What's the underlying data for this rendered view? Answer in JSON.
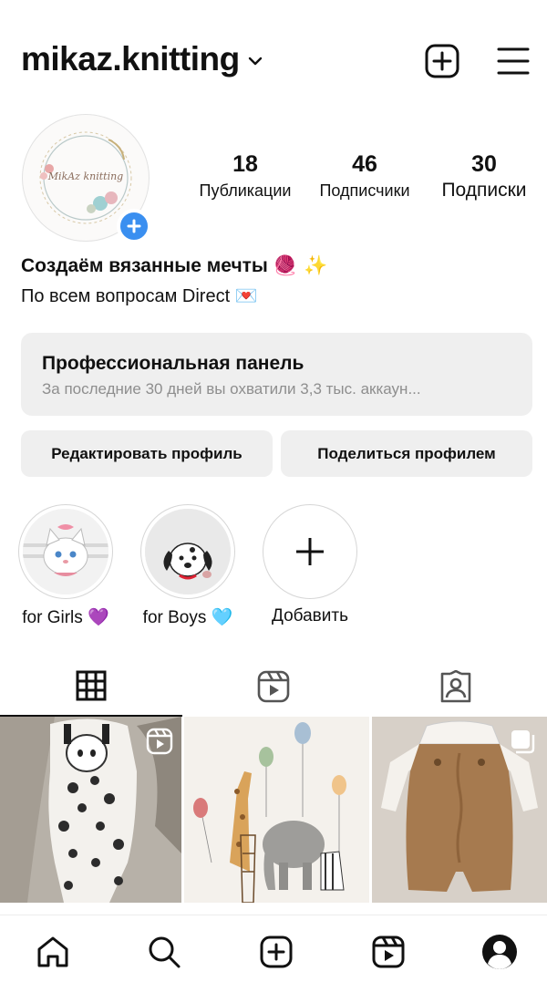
{
  "header": {
    "username": "mikaz.knitting"
  },
  "avatar": {
    "logo_text": "MikAz knitting"
  },
  "stats": {
    "posts": {
      "value": "18",
      "label": "Публикации"
    },
    "followers": {
      "value": "46",
      "label": "Подписчики"
    },
    "following": {
      "value": "30",
      "label": "Подписки"
    }
  },
  "bio": {
    "name": "Создаём вязанные мечты",
    "name_emoji": "🧶 ✨",
    "text": "По всем вопросам Direct",
    "text_emoji": "💌"
  },
  "pro_panel": {
    "title": "Профессиональная панель",
    "subtitle": "За последние 30 дней вы охватили 3,3 тыс. аккаун..."
  },
  "buttons": {
    "edit": "Редактировать профиль",
    "share": "Поделиться профилем"
  },
  "highlights": [
    {
      "label": "for Girls",
      "emoji": "💜",
      "image": "cat-illustration"
    },
    {
      "label": "for Boys",
      "emoji": "🩵",
      "image": "dalmatian-puppy-illustration"
    },
    {
      "label": "Добавить",
      "icon": "plus-icon"
    }
  ],
  "tabs": [
    {
      "icon": "grid-icon",
      "active": true
    },
    {
      "icon": "reels-icon",
      "active": false
    },
    {
      "icon": "tagged-icon",
      "active": false
    }
  ],
  "posts": [
    {
      "image": "knitted-zebra-romper",
      "badge": "reels-icon"
    },
    {
      "image": "animals-with-balloons-illustration",
      "badge": ""
    },
    {
      "image": "knitted-brown-romper",
      "badge": "carousel-icon"
    }
  ],
  "bottom_nav": [
    "home-icon",
    "search-icon",
    "create-icon",
    "reels-icon",
    "profile-icon"
  ],
  "colors": {
    "accent_blue": "#3a8ff0",
    "panel_bg": "#efefef",
    "muted_text": "#8e8e8e"
  }
}
